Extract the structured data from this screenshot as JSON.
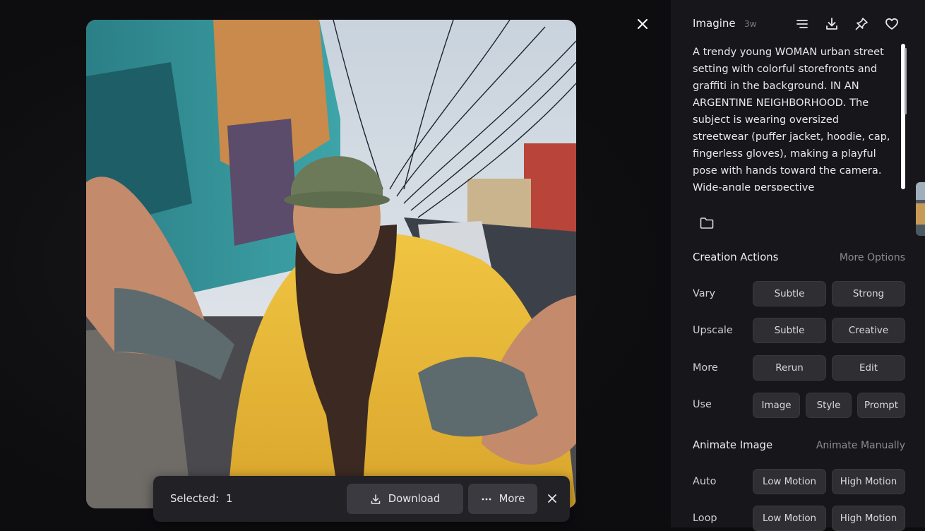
{
  "detail": {
    "title": "Imagine",
    "age": "3w",
    "prompt": "A trendy young WOMAN urban street setting with colorful storefronts and graffiti in the background. IN AN ARGENTINE NEIGHBORHOOD. The subject is wearing oversized streetwear (puffer jacket, hoodie, cap, fingerless gloves), making a playful pose with hands toward the camera. Wide-angle perspective"
  },
  "creation_actions": {
    "title": "Creation Actions",
    "more_options": "More Options",
    "rows": [
      {
        "label": "Vary",
        "buttons": [
          "Subtle",
          "Strong"
        ]
      },
      {
        "label": "Upscale",
        "buttons": [
          "Subtle",
          "Creative"
        ]
      },
      {
        "label": "More",
        "buttons": [
          "Rerun",
          "Edit"
        ]
      },
      {
        "label": "Use",
        "buttons": [
          "Image",
          "Style",
          "Prompt"
        ]
      }
    ]
  },
  "animate": {
    "title": "Animate Image",
    "manual": "Animate Manually",
    "rows": [
      {
        "label": "Auto",
        "buttons": [
          "Low Motion",
          "High Motion"
        ]
      },
      {
        "label": "Loop",
        "buttons": [
          "Low Motion",
          "High Motion"
        ]
      }
    ]
  },
  "selection_bar": {
    "label": "Selected:",
    "count": "1",
    "download": "Download",
    "more": "More"
  },
  "icons": {
    "header": [
      "list-icon",
      "download-icon",
      "pin-icon",
      "heart-icon"
    ],
    "folder": "folder-icon",
    "close": "close-icon"
  }
}
